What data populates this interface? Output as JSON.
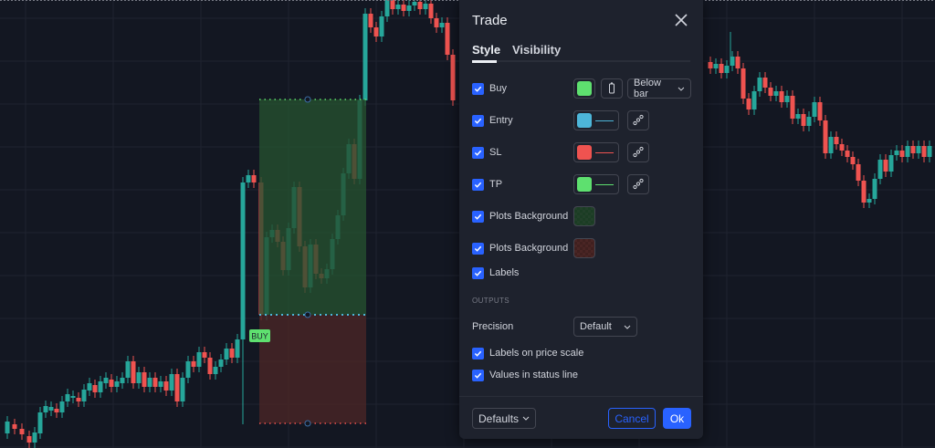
{
  "dialog": {
    "title": "Trade",
    "tabs": [
      {
        "label": "Style",
        "active": true
      },
      {
        "label": "Visibility",
        "active": false
      }
    ],
    "rows": [
      {
        "label": "Buy",
        "checked": true,
        "color": "#5ee06f",
        "placement": "Below bar"
      },
      {
        "label": "Entry",
        "checked": true,
        "color": "#4db6d9"
      },
      {
        "label": "SL",
        "checked": true,
        "color": "#ef5350"
      },
      {
        "label": "TP",
        "checked": true,
        "color": "#5ee06f"
      },
      {
        "label": "Plots Background",
        "checked": true,
        "color": "#2f6b3b"
      },
      {
        "label": "Plots Background",
        "checked": true,
        "color": "#7a3030"
      },
      {
        "label": "Labels",
        "checked": true
      }
    ],
    "outputs_label": "OUTPUTS",
    "precision": {
      "label": "Precision",
      "value": "Default"
    },
    "toggles": [
      {
        "label": "Labels on price scale",
        "checked": true
      },
      {
        "label": "Values in status line",
        "checked": true
      }
    ],
    "footer": {
      "defaults_label": "Defaults",
      "cancel_label": "Cancel",
      "ok_label": "Ok"
    }
  },
  "chart": {
    "buy_label": "BUY",
    "up_color": "#26a69a",
    "down_color": "#ef5350",
    "tp_zone_color": "#26502f",
    "sl_zone_color": "#4a2627"
  }
}
